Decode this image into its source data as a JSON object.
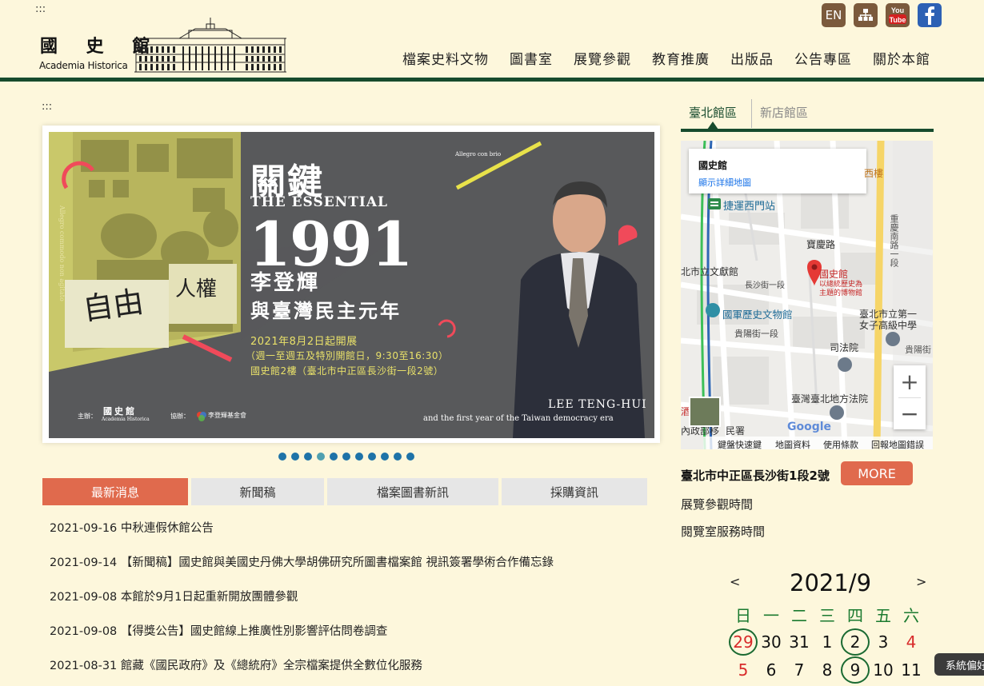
{
  "header": {
    "skip_top": ":::",
    "logo_cn": "國 史 館",
    "logo_en": "Academia Historica",
    "lang_label": "EN",
    "nav": [
      "檔案史料文物",
      "圖書室",
      "展覽參觀",
      "教育推廣",
      "出版品",
      "公告專區",
      "關於本館"
    ],
    "icons": {
      "en": "language-icon",
      "sitemap": "sitemap-icon",
      "youtube": "youtube-icon",
      "facebook": "facebook-icon"
    }
  },
  "main": {
    "skip_main": ":::",
    "banner": {
      "title_cn": "關鍵",
      "title_en": "THE ESSENTIAL",
      "year": "1991",
      "name_cn": "李登輝",
      "subtitle_cn": "與臺灣民主元年",
      "date_line1": "2021年8月2日起開展",
      "date_line2": "（週一至週五及特別開館日，9:30至16:30）",
      "date_line3": "國史館2樓（臺北市中正區長沙街一段2號）",
      "name_en": "LEE TENG-HUI",
      "subtitle_en": "and the first year of the Taiwan democracy era",
      "tag": "Allegro con brio",
      "tag_vertical": "Allegro commodo non agitato",
      "sign1": "自由",
      "sign2": "人權",
      "host_label": "主辦：",
      "host_name": "國史館",
      "host_en": "Academia Historica",
      "co_label": "協辦：",
      "co_name": "李登輝基金會"
    },
    "dots_count": 11,
    "dots_active": 3,
    "tabs": [
      "最新消息",
      "新聞稿",
      "檔案圖書新訊",
      "採購資訊"
    ],
    "news": [
      "2021-09-16 中秋連假休館公告",
      "2021-09-14 【新聞稿】國史館與美國史丹佛大學胡佛研究所圖書檔案館 視訊簽署學術合作備忘錄",
      "2021-09-08 本館於9月1日起重新開放團體參觀",
      "2021-09-08 【得獎公告】國史館線上推廣性別影響評估問卷調查",
      "2021-08-31 館藏《國民政府》及《總統府》全宗檔案提供全數位化服務"
    ]
  },
  "side": {
    "branches": [
      "臺北館區",
      "新店館區"
    ],
    "map": {
      "card_title": "國史館",
      "card_link": "顯示詳細地圖",
      "poi_main": "國史館",
      "poi_main_sub1": "以總統歷史為",
      "poi_main_sub2": "主題的博物館",
      "labels": {
        "mrt": "捷運西門站",
        "baoqing": "寶慶路",
        "wenxian": "北市立文獻館",
        "changsha": "長沙街一段",
        "museum": "國軍歷史文物館",
        "guiyang": "貴陽街一段",
        "school1": "臺北市立第一",
        "school2": "女子高級中學",
        "court": "司法院",
        "guiyang2": "貴陽街",
        "district_court": "臺灣臺北地方法院",
        "chongqing": "重慶南路一段",
        "min": "民署",
        "neizheng": "內政部移",
        "jiu": "酒",
        "lou": "西樓"
      },
      "footer": [
        "鍵盤快速鍵",
        "地圖資料",
        "使用條款",
        "回報地圖錯誤"
      ],
      "google": "Google",
      "zoom_in": "+",
      "zoom_out": "−"
    },
    "address": "臺北市中正區長沙街1段2號",
    "more": "MORE",
    "links": [
      "展覽參觀時間",
      "閱覽室服務時間"
    ],
    "calendar": {
      "prev": "<",
      "next": ">",
      "title": "2021/9",
      "weekdays": [
        "日",
        "一",
        "二",
        "三",
        "四",
        "五",
        "六"
      ],
      "row1": [
        "29",
        "30",
        "31",
        "1",
        "2",
        "3",
        "4"
      ],
      "row2": [
        "5",
        "6",
        "7",
        "8",
        "9",
        "10",
        "11"
      ]
    },
    "status": "系統偏好"
  }
}
